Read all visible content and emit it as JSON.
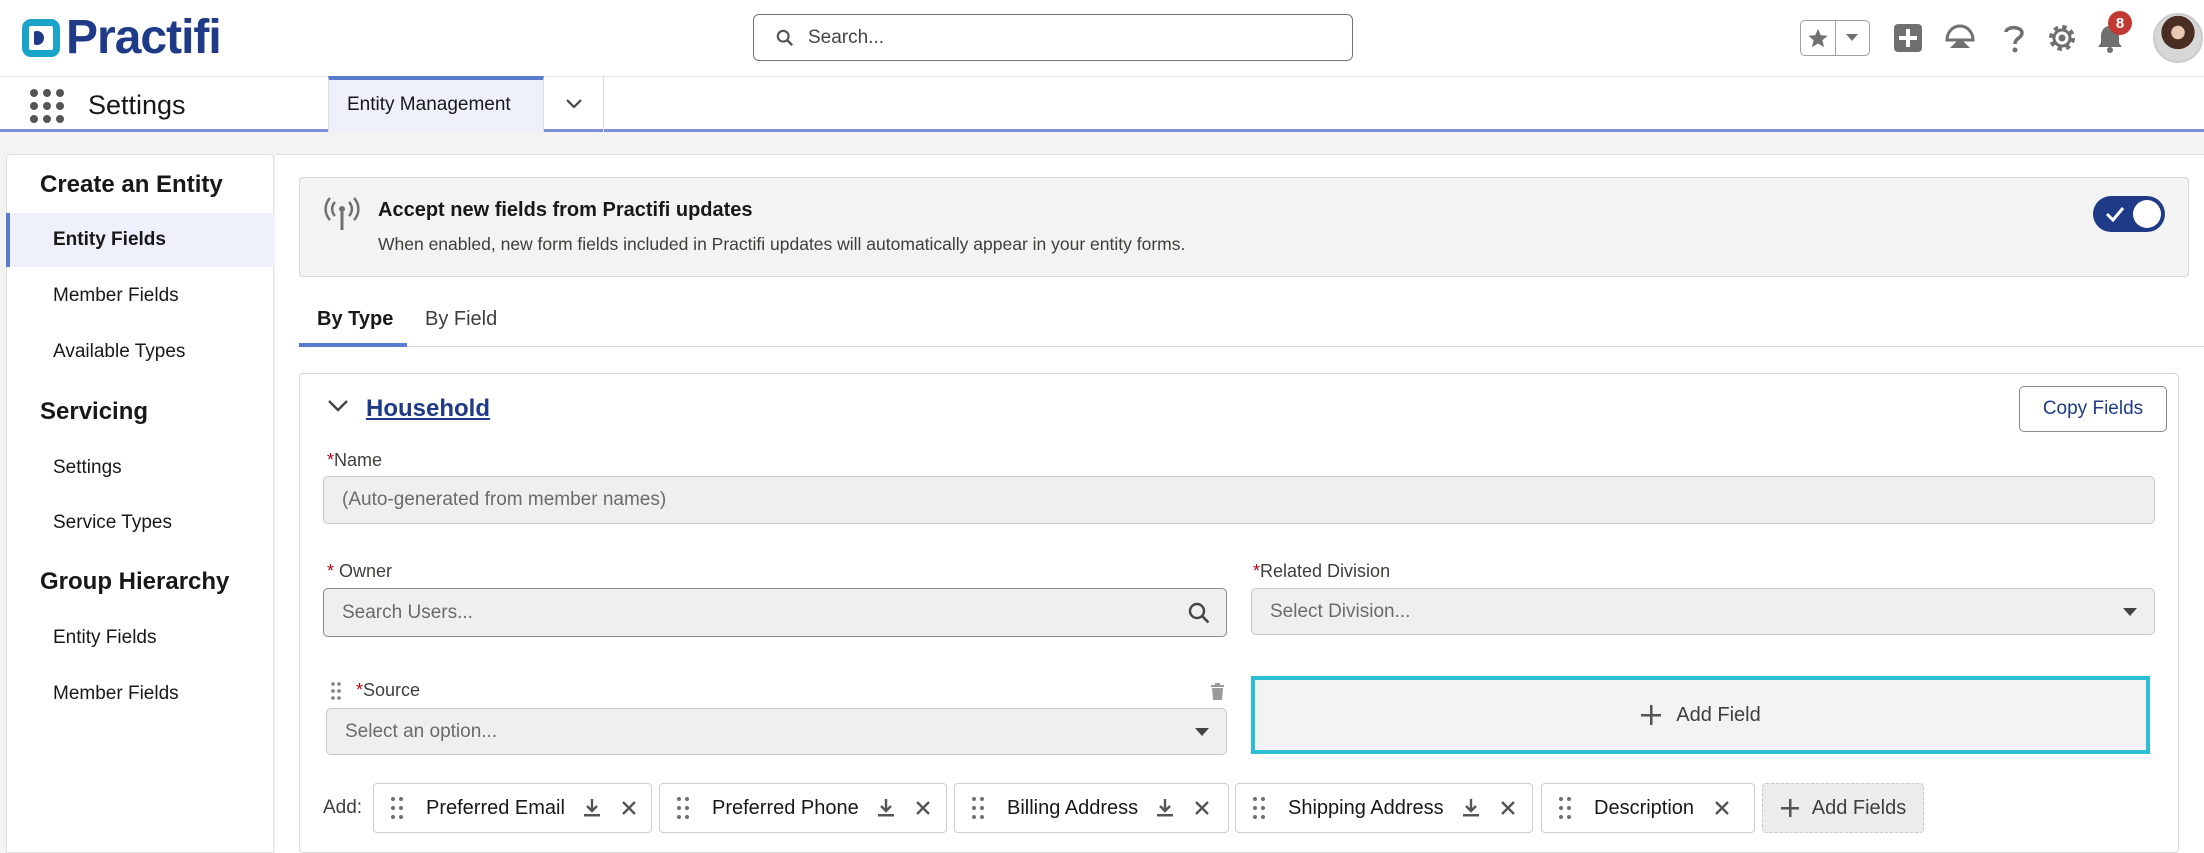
{
  "header": {
    "logo_text": "Practifi",
    "search_placeholder": "Search...",
    "notifications_count": "8"
  },
  "nav": {
    "app_name": "Settings",
    "tabs": [
      {
        "label": "Entity Management"
      }
    ]
  },
  "sidebar": {
    "sections": [
      {
        "title": "Create an Entity",
        "items": [
          "Entity Fields",
          "Member Fields",
          "Available Types"
        ]
      },
      {
        "title": "Servicing",
        "items": [
          "Settings",
          "Service Types"
        ]
      },
      {
        "title": "Group Hierarchy",
        "items": [
          "Entity Fields",
          "Member Fields"
        ]
      }
    ],
    "active_item": "Entity Fields"
  },
  "banner": {
    "title": "Accept new fields from Practifi updates",
    "description": "When enabled, new form fields included in Practifi updates will automatically appear in your entity forms.",
    "toggle_on": true
  },
  "subtabs": [
    "By Type",
    "By Field"
  ],
  "card": {
    "title": "Household",
    "copy_button": "Copy Fields",
    "fields": {
      "name": {
        "label": "Name",
        "placeholder": "(Auto-generated from member names)"
      },
      "owner": {
        "label": "Owner",
        "placeholder": "Search Users..."
      },
      "related_division": {
        "label": "Related Division",
        "placeholder": "Select Division..."
      },
      "source": {
        "label": "Source",
        "placeholder": "Select an option..."
      }
    },
    "add_field_button": "Add Field",
    "add_label": "Add:",
    "chips": [
      "Preferred Email",
      "Preferred Phone",
      "Billing Address",
      "Shipping Address",
      "Description"
    ],
    "add_fields_button": "Add Fields"
  },
  "colors": {
    "brand_navy": "#1f3b87",
    "brand_teal": "#1aa4c9",
    "accent_blue": "#5a7ccf",
    "highlight_cyan": "#2bbed4",
    "required_red": "#ba0517"
  }
}
